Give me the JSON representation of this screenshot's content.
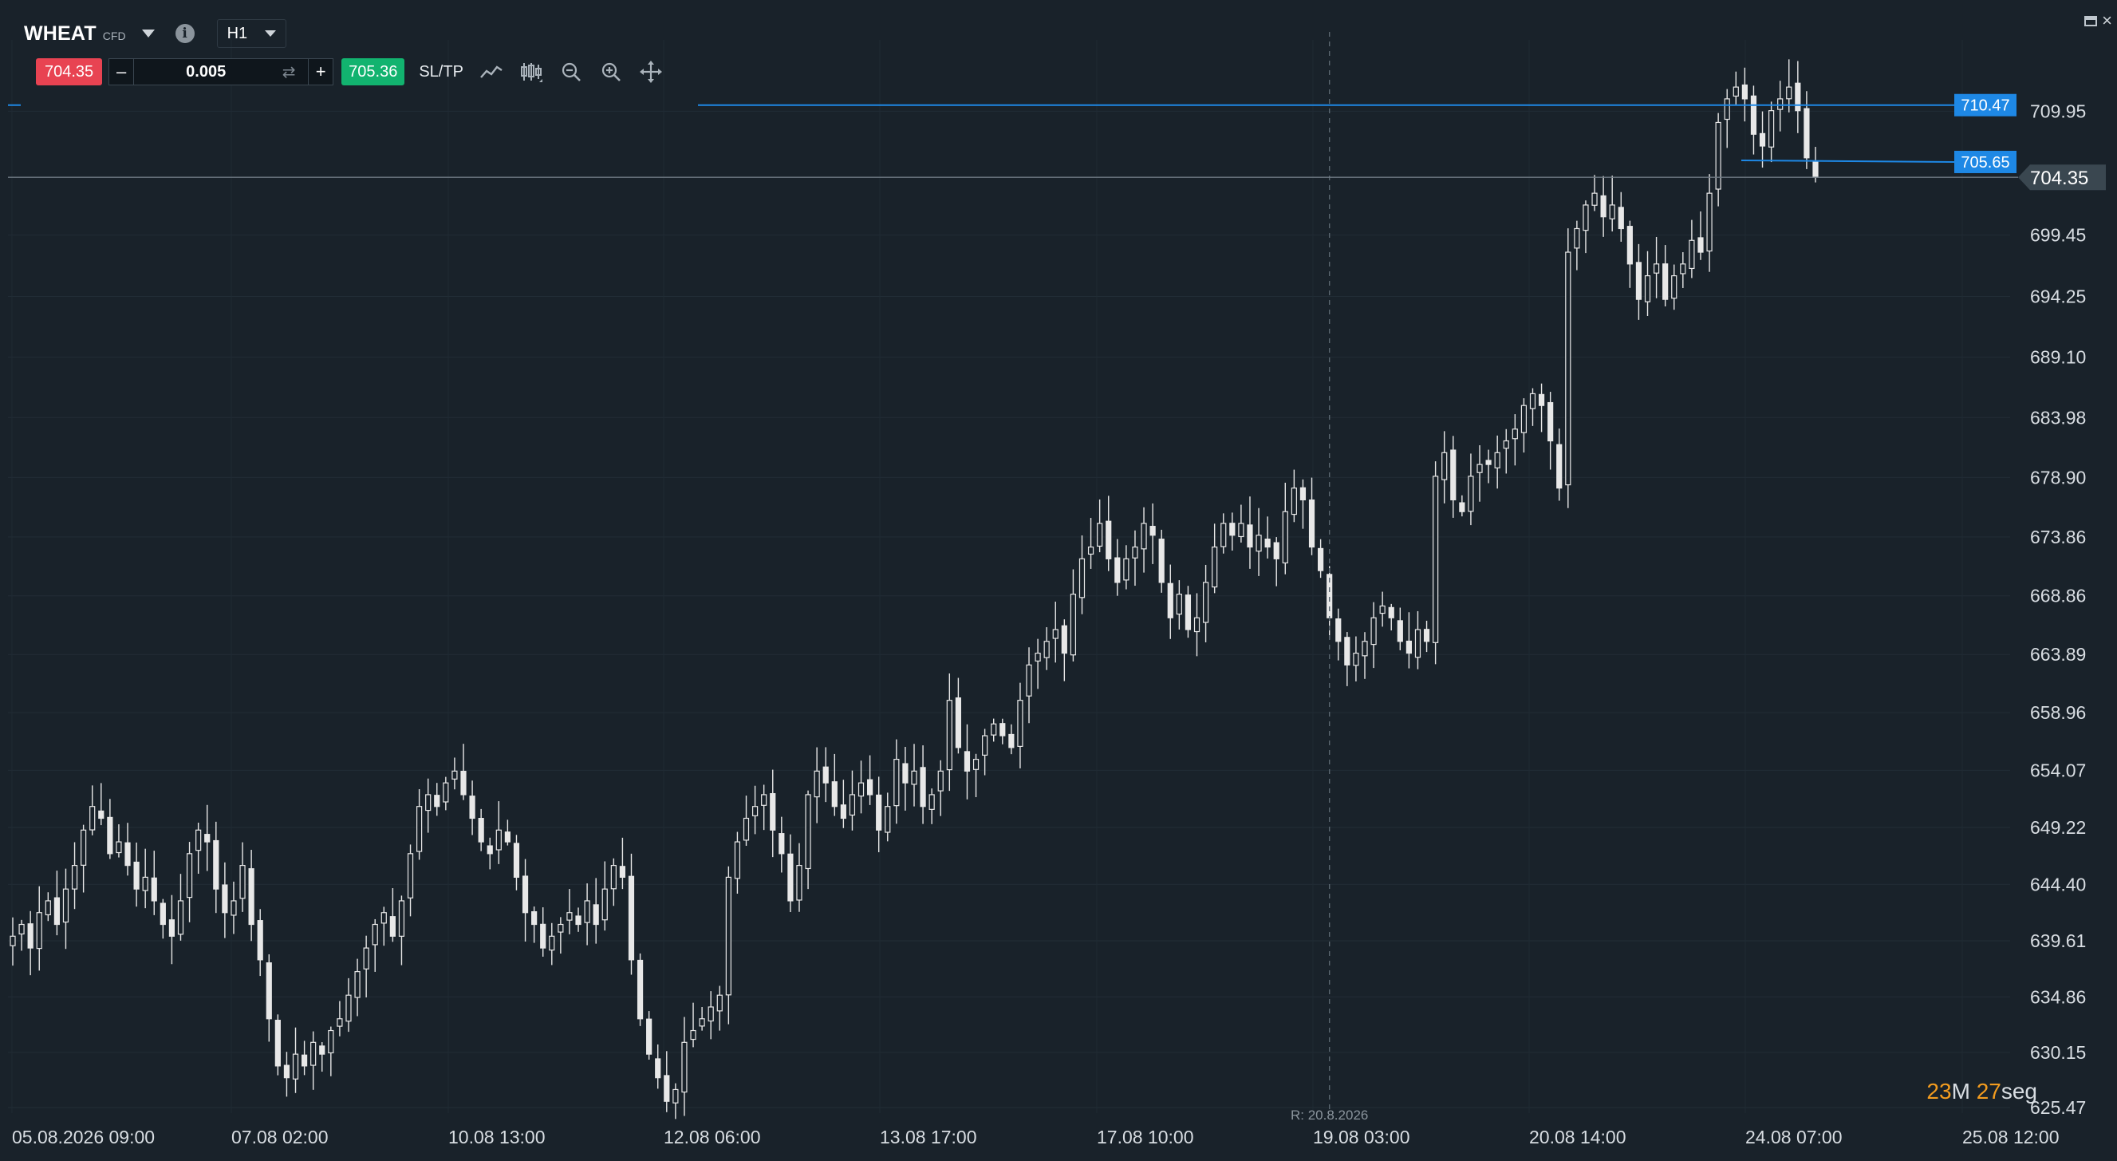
{
  "instrument": {
    "symbol": "WHEAT",
    "type": "CFD",
    "timeframe": "H1"
  },
  "trade_bar": {
    "sell_price": "704.35",
    "quantity": "0.005",
    "minus_label": "–",
    "plus_label": "+",
    "buy_price": "705.36",
    "sltp_label": "SL/TP"
  },
  "countdown": {
    "minutes": "23",
    "minutes_unit": "M",
    "seconds": "27",
    "seconds_unit": "seg"
  },
  "icons": {
    "info": "info-icon",
    "timeframe_dropdown": "chevron-down-icon",
    "swap": "swap-icon",
    "line_chart": "line-chart-icon",
    "candles": "candlestick-icon",
    "zoom_out": "zoom-out-icon",
    "zoom_in": "zoom-in-icon",
    "pan": "move-icon",
    "maximize": "maximize-icon",
    "close": "close-icon"
  },
  "colors": {
    "background": "#19222a",
    "candle": "#e8e8e8",
    "sell": "#e84352",
    "buy": "#12b36f",
    "level_line": "#1e88e5",
    "current_price_label": "#3a4750",
    "countdown_accent": "#f39c1f",
    "axis_text": "#d8dde2"
  },
  "chart_data": {
    "type": "candlestick",
    "timeframe": "H1",
    "y_ticks": [
      "709.95",
      "699.45",
      "694.25",
      "689.10",
      "683.98",
      "678.90",
      "673.86",
      "668.86",
      "663.89",
      "658.96",
      "654.07",
      "649.22",
      "644.40",
      "639.61",
      "634.86",
      "630.15",
      "625.47"
    ],
    "x_ticks": [
      "05.08.2026 09:00",
      "07.08 02:00",
      "10.08 13:00",
      "12.08 06:00",
      "13.08 17:00",
      "17.08 10:00",
      "19.08 03:00",
      "20.08 14:00",
      "24.08 07:00",
      "25.08 12:00"
    ],
    "ylim": [
      625.0,
      716.0
    ],
    "current_price": "704.35",
    "levels": [
      {
        "price": 710.47,
        "label": "710.47",
        "style": "blue-line"
      },
      {
        "price": 705.65,
        "label": "705.65",
        "style": "blue-line"
      }
    ],
    "crosshair_label": "R: 20.8.2026",
    "crosshair_x_index": 149,
    "closes": [
      640,
      641,
      639,
      642,
      643,
      641,
      644,
      646,
      649,
      651,
      650,
      647,
      648,
      646,
      644,
      645,
      643,
      641,
      640,
      643,
      647,
      649,
      648,
      644,
      642,
      643,
      646,
      641,
      638,
      633,
      629,
      628,
      630,
      629,
      631,
      630,
      632,
      633,
      635,
      637,
      639,
      641,
      642,
      640,
      643,
      647,
      651,
      652,
      651,
      653,
      654,
      652,
      650,
      648,
      647,
      649,
      648,
      645,
      642,
      641,
      639,
      640,
      641,
      642,
      641,
      643,
      641,
      644,
      646,
      645,
      638,
      633,
      630,
      628,
      626,
      627,
      631,
      632,
      633,
      634,
      635,
      645,
      648,
      650,
      651,
      652,
      649,
      647,
      643,
      646,
      652,
      654,
      653,
      651,
      650,
      652,
      653,
      652,
      649,
      651,
      655,
      653,
      654,
      651,
      652,
      654,
      660,
      656,
      654,
      655,
      657,
      658,
      657,
      656,
      660,
      663,
      664,
      665,
      666,
      664,
      669,
      672,
      673,
      675,
      672,
      670,
      672,
      673,
      675,
      674,
      670,
      667,
      669,
      666,
      667,
      670,
      673,
      675,
      674,
      675,
      673,
      674,
      673,
      672,
      676,
      678,
      677,
      673,
      671,
      667,
      665,
      663,
      664,
      665,
      667,
      668,
      667,
      665,
      664,
      666,
      665,
      679,
      681,
      677,
      676,
      679,
      680,
      680,
      681,
      682,
      683,
      685,
      686,
      685,
      682,
      678,
      698,
      700,
      702,
      703,
      701,
      702,
      700,
      697,
      694,
      696,
      697,
      694,
      696,
      697,
      699,
      698,
      703,
      709,
      711,
      712,
      711,
      708,
      707,
      710,
      711,
      712,
      710,
      706,
      704.35
    ]
  }
}
